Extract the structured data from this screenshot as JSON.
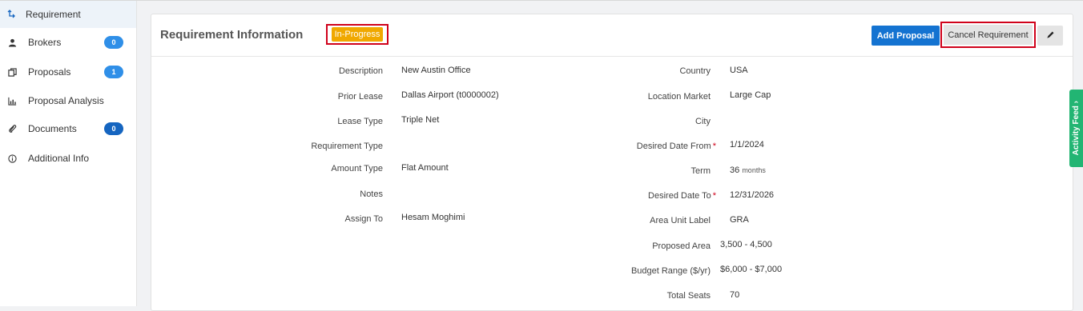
{
  "sidebar": {
    "items": [
      {
        "label": "Requirement",
        "icon": "branch-icon",
        "active": true
      },
      {
        "label": "Brokers",
        "icon": "user-icon",
        "badge": "0"
      },
      {
        "label": "Proposals",
        "icon": "copy-icon",
        "badge": "1"
      },
      {
        "label": "Proposal Analysis",
        "icon": "bar-chart-icon"
      },
      {
        "label": "Documents",
        "icon": "paperclip-icon",
        "badge": "0"
      },
      {
        "label": "Additional Info",
        "icon": "info-icon"
      }
    ]
  },
  "card": {
    "title": "Requirement Information",
    "status": "In-Progress",
    "status_color": "#f0a800",
    "buttons": {
      "add_proposal": "Add Proposal",
      "cancel_requirement": "Cancel Requirement",
      "edit_icon": "pencil-icon"
    }
  },
  "left_fields": [
    {
      "label": "Description",
      "value": "New Austin Office"
    },
    {
      "label": "Prior Lease",
      "value": "Dallas Airport (t0000002)"
    },
    {
      "label": "Lease Type",
      "value": "Triple Net"
    },
    {
      "label": "Requirement Type",
      "value": ""
    },
    {
      "label": "Amount Type",
      "value": "Flat Amount"
    },
    {
      "label": "Notes",
      "value": ""
    },
    {
      "label": "Assign To",
      "value": "Hesam Moghimi"
    }
  ],
  "right_fields": [
    {
      "label": "Country",
      "value": "USA"
    },
    {
      "label": "Location Market",
      "value": "Large Cap"
    },
    {
      "label": "City",
      "value": ""
    },
    {
      "label": "Desired Date From",
      "value": "1/1/2024",
      "required": "*"
    },
    {
      "label": "Term",
      "value": "36",
      "unit": "months"
    },
    {
      "label": "Desired Date To",
      "value": "12/31/2026",
      "required": "*"
    },
    {
      "label": "Area Unit Label",
      "value": "GRA"
    },
    {
      "label": "Proposed Area",
      "value": "3,500 - 4,500"
    },
    {
      "label": "Budget Range ($/yr)",
      "value": "$6,000 - $7,000"
    },
    {
      "label": "Total Seats",
      "value": "70"
    }
  ],
  "activity_feed": {
    "label": "Activity Feed",
    "icon": "chevron-up-icon"
  }
}
